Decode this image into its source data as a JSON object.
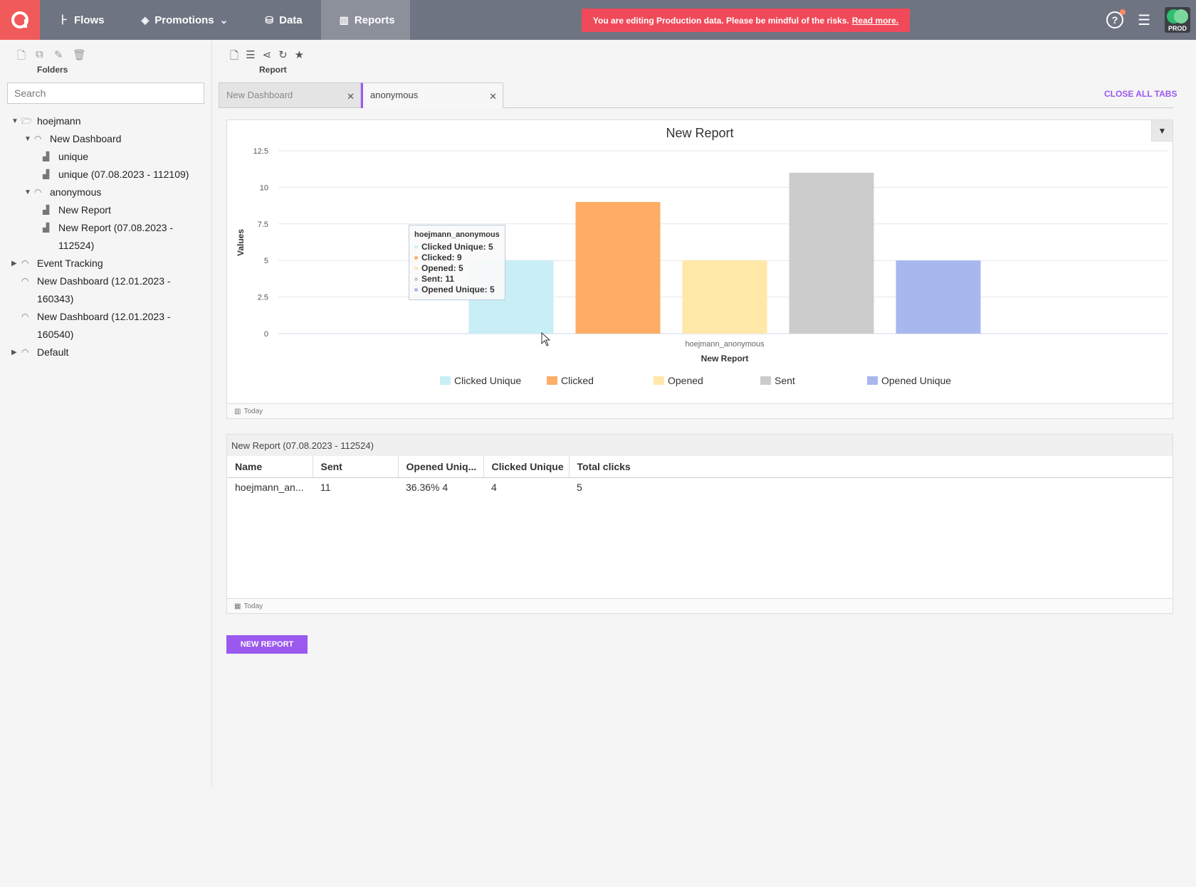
{
  "nav": {
    "items": [
      {
        "label": "Flows",
        "icon": "flows-icon"
      },
      {
        "label": "Promotions",
        "icon": "layers-icon"
      },
      {
        "label": "Data",
        "icon": "database-icon"
      },
      {
        "label": "Reports",
        "icon": "bar-chart-icon"
      }
    ],
    "warning_text": "You are editing Production data. Please be mindful of the risks.",
    "warning_link": "Read more.",
    "env_badge": "PROD"
  },
  "sidebar": {
    "folders_label": "Folders",
    "search_placeholder": "Search",
    "tree": [
      {
        "label": "hoejmann"
      },
      {
        "label": "New Dashboard"
      },
      {
        "label": "unique"
      },
      {
        "label": "unique (07.08.2023 - 112109)"
      },
      {
        "label": "anonymous"
      },
      {
        "label": "New Report"
      },
      {
        "label": "New Report (07.08.2023 -",
        "label2": "112524)"
      },
      {
        "label": "Event Tracking"
      },
      {
        "label": "New Dashboard (12.01.2023 -",
        "label2": "160343)"
      },
      {
        "label": "New Dashboard (12.01.2023 -",
        "label2": "160540)"
      },
      {
        "label": "Default"
      }
    ]
  },
  "report_toolbar": {
    "label": "Report"
  },
  "tabs": [
    {
      "label": "New Dashboard"
    },
    {
      "label": "anonymous"
    }
  ],
  "close_all_label": "CLOSE ALL TABS",
  "chart_panel": {
    "footer": "Today",
    "tooltip": {
      "title": "hoejmann_anonymous",
      "rows": [
        "Clicked Unique: 5",
        "Clicked: 9",
        "Opened: 5",
        "Sent: 11",
        "Opened Unique: 5"
      ]
    }
  },
  "chart_data": {
    "type": "bar",
    "title": "New Report",
    "xlabel": "New Report",
    "ylabel": "Values",
    "categories": [
      "hoejmann_anonymous"
    ],
    "ylim": [
      0,
      12.5
    ],
    "yticks": [
      "0",
      "2.5",
      "5",
      "7.5",
      "10",
      "12.5"
    ],
    "series": [
      {
        "name": "Clicked Unique",
        "values": [
          5
        ],
        "color": "#c9eef6"
      },
      {
        "name": "Clicked",
        "values": [
          9
        ],
        "color": "#ffad66"
      },
      {
        "name": "Opened",
        "values": [
          5
        ],
        "color": "#ffe8a8"
      },
      {
        "name": "Sent",
        "values": [
          11
        ],
        "color": "#cccccc"
      },
      {
        "name": "Opened Unique",
        "values": [
          5
        ],
        "color": "#a8b8ee"
      }
    ],
    "legend": "bottom"
  },
  "table_panel": {
    "title": "New Report (07.08.2023 - 112524)",
    "columns": [
      "Name",
      "Sent",
      "Opened Uniq...",
      "Clicked Unique",
      "Total clicks"
    ],
    "rows": [
      [
        "hoejmann_an...",
        "11",
        "36.36% 4",
        "4",
        "5"
      ]
    ],
    "footer": "Today"
  },
  "new_report_label": "NEW REPORT",
  "colors": {
    "accent": "#9b59f0",
    "warning": "#f04a5a",
    "nav": "#6e7482",
    "logo": "#f15a5a"
  }
}
